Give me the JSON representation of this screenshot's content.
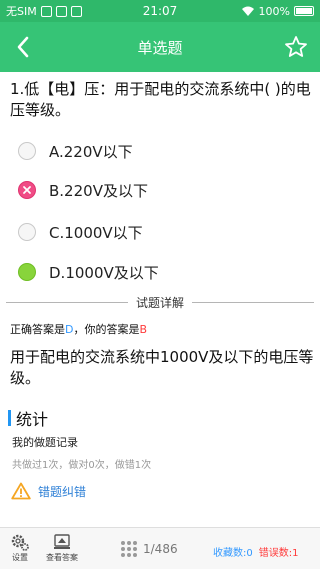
{
  "status_bar": {
    "carrier": "无SIM",
    "time": "21:07",
    "battery": "100%"
  },
  "header": {
    "title": "单选题",
    "back_icon": "chevron-left-icon",
    "favorite_icon": "star-outline-icon"
  },
  "question": {
    "text": "1.低【电】压：用于配电的交流系统中( )的电压等级。",
    "options": [
      {
        "label": "A.220V以下",
        "state": "unselected"
      },
      {
        "label": "B.220V及以下",
        "state": "wrong"
      },
      {
        "label": "C.1000V以下",
        "state": "unselected"
      },
      {
        "label": "D.1000V及以下",
        "state": "correct"
      }
    ]
  },
  "details": {
    "section_label": "试题详解",
    "correct_prefix": "正确答案是",
    "correct_answer": "D",
    "user_prefix": "，你的答案是",
    "user_answer": "B",
    "explanation": "用于配电的交流系统中1000V及以下的电压等级。"
  },
  "stats": {
    "title": "统计",
    "record_title": "我的做题记录",
    "record_detail": "共做过1次，做对0次，做错1次"
  },
  "report": {
    "label": "错题纠错",
    "icon": "warning-icon"
  },
  "bottom_bar": {
    "settings_label": "设置",
    "view_answer_label": "查看答案",
    "progress": "1/486",
    "favorites": "收藏数:0",
    "errors": "错误数:1"
  },
  "colors": {
    "header": "#36c476",
    "status": "#2fb86a",
    "wrong": "#f04c86",
    "correct": "#88d43b",
    "link": "#2d7fd6"
  }
}
